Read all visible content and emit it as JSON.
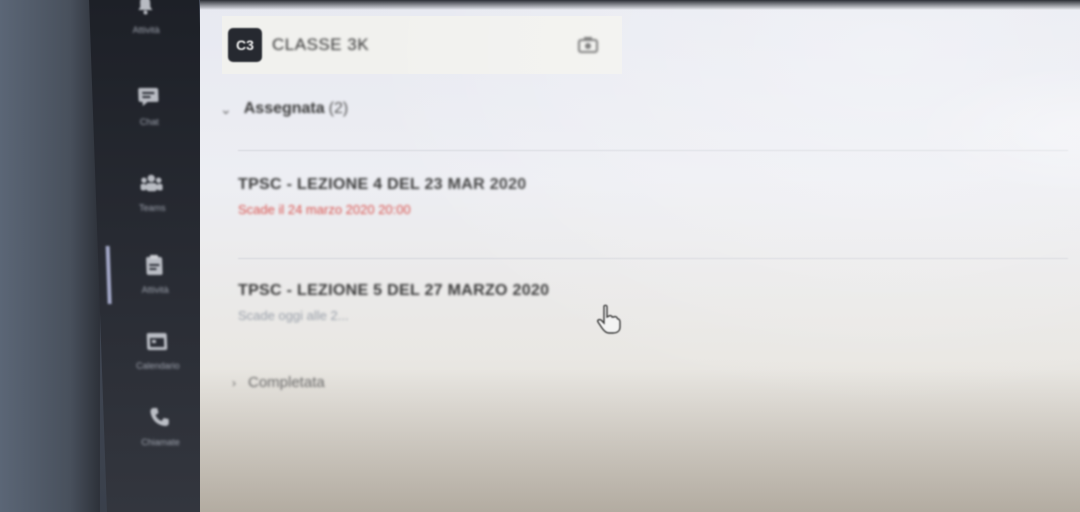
{
  "team": {
    "avatar_text": "C3",
    "name": "CLASSE 3K"
  },
  "appbar": {
    "items": [
      {
        "label": "Attività",
        "icon": "bell-icon"
      },
      {
        "label": "Chat",
        "icon": "chat-icon"
      },
      {
        "label": "Teams",
        "icon": "teams-icon"
      },
      {
        "label": "Attività",
        "icon": "assignments-icon"
      },
      {
        "label": "Calendario",
        "icon": "calendar-icon"
      },
      {
        "label": "Chiamate",
        "icon": "phone-icon"
      }
    ]
  },
  "assigned_section": {
    "title": "Assegnata",
    "count": "(2)"
  },
  "assignments": [
    {
      "title": "TPSC - LEZIONE 4 DEL 23 MAR 2020",
      "due": "Scade il 24 marzo 2020 20:00",
      "status": "late"
    },
    {
      "title": "TPSC - LEZIONE 5 DEL 27 MARZO 2020",
      "due": "Scade oggi alle 2...",
      "status": "soon"
    }
  ],
  "completed_section": {
    "title": "Completata"
  },
  "colors": {
    "late": "#d9534f",
    "appbar": "#1d2027",
    "screen_bg": "#eceef3"
  }
}
